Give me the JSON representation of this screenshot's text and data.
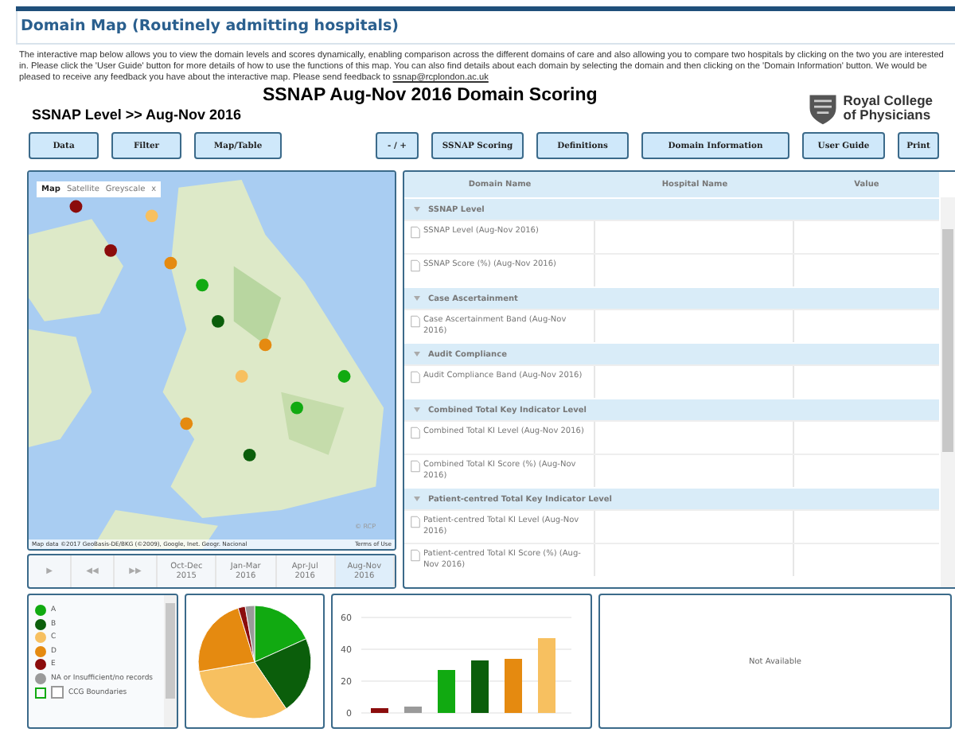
{
  "page_title": "Domain Map (Routinely admitting hospitals)",
  "intro": {
    "text": "The interactive map below allows you to view the domain levels and scores dynamically, enabling comparison across the different domains of care and also allowing you to compare two hospitals by clicking on the two you are interested in. Please click the 'User Guide' button for more details of how to use the functions of this map. You can also find details about each domain by selecting the domain and then clicking on the 'Domain Information' button. We would be pleased to receive any feedback you have about the interactive map. Please send feedback to",
    "link": "ssnap@rcplondon.ac.uk"
  },
  "dashboard_title": "SSNAP Aug-Nov 2016 Domain Scoring",
  "breadcrumb": "SSNAP Level >> Aug-Nov 2016",
  "logo": {
    "line1": "Royal College",
    "line2": "of Physicians"
  },
  "buttons_left": [
    "Data",
    "Filter",
    "Map/Table"
  ],
  "buttons_right": [
    "- / +",
    "SSNAP Scoring",
    "Definitions",
    "Domain Information",
    "User Guide",
    "Print"
  ],
  "map": {
    "map_types": [
      {
        "label": "Map",
        "selected": true
      },
      {
        "label": "Satellite",
        "selected": false
      },
      {
        "label": "Greyscale",
        "selected": false
      }
    ],
    "close": "x",
    "copyright": "© RCP",
    "attribution": "Map data ©2017 GeoBasis-DE/BKG (©2009), Google, Inet. Geogr. Nacional",
    "terms": "Terms of Use"
  },
  "timeline": {
    "controls": [
      "▶",
      "◀◀",
      "▶▶"
    ],
    "periods": [
      {
        "label": "Oct-Dec 2015",
        "selected": false
      },
      {
        "label": "Jan-Mar 2016",
        "selected": false
      },
      {
        "label": "Apr-Jul 2016",
        "selected": false
      },
      {
        "label": "Aug-Nov 2016",
        "selected": true
      }
    ]
  },
  "table": {
    "columns": [
      "Domain Name",
      "Hospital Name",
      "Value"
    ],
    "groups": [
      {
        "name": "SSNAP Level",
        "expanded": true,
        "rows": [
          "SSNAP Level (Aug-Nov 2016)",
          "SSNAP Score (%) (Aug-Nov 2016)"
        ]
      },
      {
        "name": "Case Ascertainment",
        "expanded": true,
        "rows": [
          "Case Ascertainment Band (Aug-Nov 2016)"
        ]
      },
      {
        "name": "Audit Compliance",
        "expanded": true,
        "rows": [
          "Audit Compliance Band (Aug-Nov 2016)"
        ]
      },
      {
        "name": "Combined Total Key Indicator Level",
        "expanded": true,
        "rows": [
          "Combined Total KI Level (Aug-Nov 2016)",
          "Combined Total KI Score (%) (Aug-Nov 2016)"
        ]
      },
      {
        "name": "Patient-centred Total Key Indicator Level",
        "expanded": true,
        "rows": [
          "Patient-centred Total KI Level (Aug-Nov 2016)",
          "Patient-centred Total KI Score (%) (Aug-Nov 2016)"
        ]
      }
    ]
  },
  "legend": {
    "items": [
      {
        "label": "A",
        "color": "#11aa11"
      },
      {
        "label": "B",
        "color": "#0b5e0b"
      },
      {
        "label": "C",
        "color": "#f7c060"
      },
      {
        "label": "D",
        "color": "#e58a10"
      },
      {
        "label": "E",
        "color": "#8b0c0c"
      },
      {
        "label": "NA or Insufficient/no records",
        "color": "#9a9a9a"
      }
    ],
    "boundaries": {
      "label": "CCG Boundaries",
      "checked": false
    }
  },
  "bar_chart": {
    "chart_data": {
      "type": "bar",
      "yticks": [
        0,
        20,
        40,
        60
      ],
      "ylim": [
        0,
        60
      ],
      "series": [
        {
          "color": "#8b0c0c",
          "values": [
            3
          ]
        },
        {
          "color": "#9a9a9a",
          "values": [
            4
          ]
        },
        {
          "color": "#11aa11",
          "values": [
            27
          ]
        },
        {
          "color": "#0b5e0b",
          "values": [
            33
          ]
        },
        {
          "color": "#e58a10",
          "values": [
            34
          ]
        },
        {
          "color": "#f7c060",
          "values": [
            47
          ]
        }
      ]
    }
  },
  "comparison_panel": {
    "message": "Not Available"
  }
}
